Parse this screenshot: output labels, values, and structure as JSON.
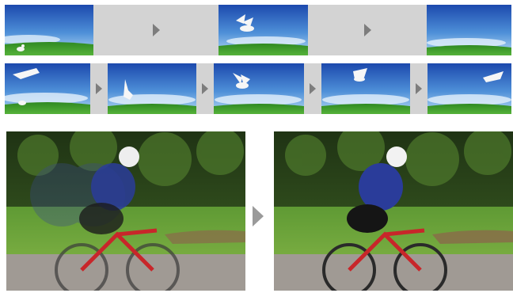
{
  "figure": {
    "top_row": {
      "frames": [
        {
          "name": "frame-1",
          "content": "dove-on-ground"
        },
        {
          "name": "frame-2",
          "content": "dove-flying"
        },
        {
          "name": "frame-3",
          "content": "empty-sky"
        }
      ],
      "arrow_icon": "play-triangle-icon"
    },
    "middle_row": {
      "frames": [
        {
          "name": "frame-1",
          "content": "dove-landing"
        },
        {
          "name": "frame-2",
          "content": "dove-rising"
        },
        {
          "name": "frame-3",
          "content": "dove-flying"
        },
        {
          "name": "frame-4",
          "content": "dove-high"
        },
        {
          "name": "frame-5",
          "content": "dove-leaving"
        }
      ],
      "arrow_icon": "play-triangle-icon"
    },
    "bottom_row": {
      "panels": [
        {
          "name": "blurred-cyclist",
          "style": "motion-blur"
        },
        {
          "name": "sharp-cyclist",
          "style": "sharp"
        }
      ],
      "arrow_icon": "play-triangle-icon"
    },
    "colors": {
      "sky_top": "#1f4fb0",
      "sky_bottom": "#9fd0f0",
      "grass": "#3c9a2c",
      "gap_gray": "#d3d3d3",
      "arrow_gray": "#7d7d7d",
      "foliage": "#2e4a1e",
      "road": "#9a9590",
      "bike_red": "#c8262a",
      "jersey_blue": "#2a3c9a"
    }
  }
}
